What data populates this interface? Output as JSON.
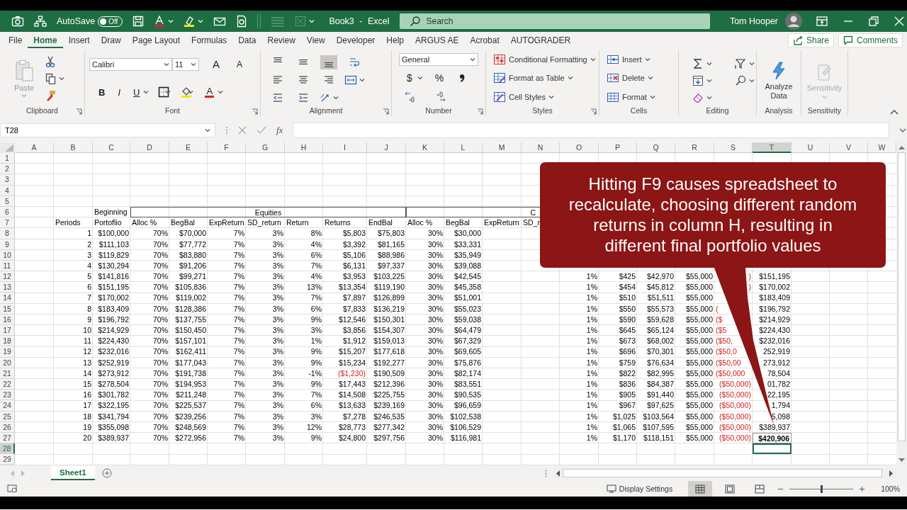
{
  "title_bar": {
    "autosave": {
      "label": "AutoSave",
      "on": false,
      "state": "Off"
    },
    "document": "Book3 - Excel",
    "search": {
      "placeholder": "Search"
    },
    "user": "Tom Hooper"
  },
  "menu_tabs": [
    {
      "label": "File",
      "selected": false
    },
    {
      "label": "Home",
      "selected": true
    },
    {
      "label": "Insert",
      "selected": false
    },
    {
      "label": "Draw",
      "selected": false
    },
    {
      "label": "Page Layout",
      "selected": false
    },
    {
      "label": "Formulas",
      "selected": false
    },
    {
      "label": "Data",
      "selected": false
    },
    {
      "label": "Review",
      "selected": false
    },
    {
      "label": "View",
      "selected": false
    },
    {
      "label": "Developer",
      "selected": false
    },
    {
      "label": "Help",
      "selected": false
    },
    {
      "label": "ARGUS AE",
      "selected": false
    },
    {
      "label": "Acrobat",
      "selected": false
    },
    {
      "label": "AUTOGRADER",
      "selected": false
    }
  ],
  "share": {
    "label": "Share"
  },
  "comments": {
    "label": "Comments"
  },
  "ribbon": {
    "clipboard": {
      "label": "Clipboard",
      "paste": {
        "label": "Paste",
        "disabled": true
      }
    },
    "font": {
      "label": "Font",
      "name": "Calibri",
      "size": "11",
      "grow": "A",
      "shrink": "A",
      "bold": "B",
      "italic": "I",
      "underline": "U",
      "font_color": "A"
    },
    "alignment": {
      "label": "Alignment",
      "vertical": [
        {
          "selected": false
        },
        {
          "selected": false
        },
        {
          "selected": true
        }
      ]
    },
    "number": {
      "label": "Number",
      "format": "General",
      "currency": "$",
      "percent": "%"
    },
    "styles": {
      "label": "Styles",
      "items": [
        "Conditional Formatting",
        "Format as Table",
        "Cell Styles"
      ]
    },
    "cells": {
      "label": "Cells",
      "items": [
        "Insert",
        "Delete",
        "Format"
      ]
    },
    "editing": {
      "label": "Editing"
    },
    "analysis": {
      "label": "Analysis",
      "button": "Analyze Data"
    },
    "sensitivity": {
      "label": "Sensitivity",
      "button": {
        "label": "Sensitivity",
        "disabled": true
      }
    }
  },
  "formula_bar": {
    "name_box": "T28",
    "fx": "fx"
  },
  "sheet": {
    "columns": {
      "A": {
        "label": "A",
        "selected": false
      },
      "B": {
        "label": "B",
        "selected": false
      },
      "C": {
        "label": "C",
        "selected": false
      },
      "D": {
        "label": "D",
        "selected": false
      },
      "E": {
        "label": "E",
        "selected": false
      },
      "F": {
        "label": "F",
        "selected": false
      },
      "G": {
        "label": "G",
        "selected": false
      },
      "H": {
        "label": "H",
        "selected": false
      },
      "I": {
        "label": "I",
        "selected": false
      },
      "J": {
        "label": "J",
        "selected": false
      },
      "K": {
        "label": "K",
        "selected": false
      },
      "L": {
        "label": "L",
        "selected": false
      },
      "M": {
        "label": "M",
        "selected": false
      },
      "N": {
        "label": "N",
        "selected": false
      },
      "O": {
        "label": "O",
        "selected": false
      },
      "P": {
        "label": "P",
        "selected": false
      },
      "Q": {
        "label": "Q",
        "selected": false
      },
      "R": {
        "label": "R",
        "selected": false
      },
      "S": {
        "label": "S",
        "selected": false
      },
      "T": {
        "label": "T",
        "selected": true
      },
      "U": {
        "label": "U",
        "selected": false
      },
      "V": {
        "label": "V",
        "selected": false
      },
      "W": {
        "label": "W",
        "selected": false
      }
    },
    "rows": [
      {
        "number": "1",
        "selected": false
      },
      {
        "number": "2",
        "selected": false
      },
      {
        "number": "3",
        "selected": false
      },
      {
        "number": "4",
        "selected": false
      },
      {
        "number": "5",
        "selected": false
      },
      {
        "number": "6",
        "selected": false,
        "kind": "header",
        "cells": {
          "C": "Beginning",
          "D-J": "Equities",
          "K-N": {
            "text": "C",
            "cut_right": true
          }
        }
      },
      {
        "number": "7",
        "selected": false,
        "kind": "header",
        "cells": {
          "B": "Periods",
          "C": "Portoflio",
          "D": "Alloc %",
          "E": "BegBal",
          "F": "ExpReturn",
          "G": "SD_return",
          "H": "Return",
          "I": "Returns",
          "J": "EndBal",
          "K": "Alloc %",
          "L": "BegBal",
          "M": "ExpReturn",
          "N": "SD_r"
        }
      },
      {
        "number": "8",
        "selected": false,
        "kind": "data",
        "cells": {
          "B": "1",
          "C": "$100,000",
          "D": "70%",
          "E": "$70,000",
          "F": "7%",
          "G": "3%",
          "H": "8%",
          "I": "$5,803",
          "J": "$75,803",
          "K": "30%",
          "L": "$30,000"
        }
      },
      {
        "number": "9",
        "selected": false,
        "kind": "data",
        "cells": {
          "B": "2",
          "C": "$111,103",
          "D": "70%",
          "E": "$77,772",
          "F": "7%",
          "G": "3%",
          "H": "4%",
          "I": "$3,392",
          "J": "$81,165",
          "K": "30%",
          "L": "$33,331"
        }
      },
      {
        "number": "10",
        "selected": false,
        "kind": "data",
        "cells": {
          "B": "3",
          "C": "$119,829",
          "D": "70%",
          "E": "$83,880",
          "F": "7%",
          "G": "3%",
          "H": "6%",
          "I": "$5,106",
          "J": "$88,986",
          "K": "30%",
          "L": "$35,949"
        }
      },
      {
        "number": "11",
        "selected": false,
        "kind": "data",
        "cells": {
          "B": "4",
          "C": "$130,294",
          "D": "70%",
          "E": "$91,206",
          "F": "7%",
          "G": "3%",
          "H": "7%",
          "I": "$6,131",
          "J": "$97,337",
          "K": "30%",
          "L": "$39,088"
        }
      },
      {
        "number": "12",
        "selected": false,
        "kind": "data",
        "cells": {
          "B": "5",
          "C": "$141,816",
          "D": "70%",
          "E": "$99,271",
          "F": "7%",
          "G": "3%",
          "H": "4%",
          "I": "$3,953",
          "J": "$103,225",
          "K": "30%",
          "L": "$42,545",
          "O": "1%",
          "P": "$425",
          "Q": "$42,970",
          "R": "$55,000",
          "S": {
            "text": ")",
            "negative": true
          },
          "T": "$151,195"
        }
      },
      {
        "number": "13",
        "selected": false,
        "kind": "data",
        "cells": {
          "B": "6",
          "C": "$151,195",
          "D": "70%",
          "E": "$105,836",
          "F": "7%",
          "G": "3%",
          "H": "13%",
          "I": "$13,354",
          "J": "$119,190",
          "K": "30%",
          "L": "$45,358",
          "O": "1%",
          "P": "$454",
          "Q": "$45,812",
          "R": "$55,000",
          "S": {
            "text": ")",
            "negative": true
          },
          "T": "$170,002"
        }
      },
      {
        "number": "14",
        "selected": false,
        "kind": "data",
        "cells": {
          "B": "7",
          "C": "$170,002",
          "D": "70%",
          "E": "$119,002",
          "F": "7%",
          "G": "3%",
          "H": "7%",
          "I": "$7,897",
          "J": "$126,899",
          "K": "30%",
          "L": "$51,001",
          "O": "1%",
          "P": "$510",
          "Q": "$51,511",
          "R": "$55,000",
          "T": "$183,409"
        }
      },
      {
        "number": "15",
        "selected": false,
        "kind": "data",
        "cells": {
          "B": "8",
          "C": "$183,409",
          "D": "70%",
          "E": "$128,386",
          "F": "7%",
          "G": "3%",
          "H": "6%",
          "I": "$7,833",
          "J": "$136,219",
          "K": "30%",
          "L": "$55,023",
          "O": "1%",
          "P": "$550",
          "Q": "$55,573",
          "R": "$55,000",
          "S": {
            "text": "(",
            "negative": true,
            "cut_right": true
          },
          "T": "$196,792"
        }
      },
      {
        "number": "16",
        "selected": false,
        "kind": "data",
        "cells": {
          "B": "9",
          "C": "$196,792",
          "D": "70%",
          "E": "$137,755",
          "F": "7%",
          "G": "3%",
          "H": "9%",
          "I": "$12,546",
          "J": "$150,301",
          "K": "30%",
          "L": "$59,038",
          "O": "1%",
          "P": "$590",
          "Q": "$59,628",
          "R": "$55,000",
          "S": {
            "text": "($",
            "negative": true,
            "cut_right": true
          },
          "T": "$214,929"
        }
      },
      {
        "number": "17",
        "selected": false,
        "kind": "data",
        "cells": {
          "B": "10",
          "C": "$214,929",
          "D": "70%",
          "E": "$150,450",
          "F": "7%",
          "G": "3%",
          "H": "3%",
          "I": "$3,856",
          "J": "$154,307",
          "K": "30%",
          "L": "$64,479",
          "O": "1%",
          "P": "$645",
          "Q": "$65,124",
          "R": "$55,000",
          "S": {
            "text": "($5",
            "negative": true,
            "cut_right": true
          },
          "T": "$224,430"
        }
      },
      {
        "number": "18",
        "selected": false,
        "kind": "data",
        "cells": {
          "B": "11",
          "C": "$224,430",
          "D": "70%",
          "E": "$157,101",
          "F": "7%",
          "G": "3%",
          "H": "1%",
          "I": "$1,912",
          "J": "$159,013",
          "K": "30%",
          "L": "$67,329",
          "O": "1%",
          "P": "$673",
          "Q": "$68,002",
          "R": "$55,000",
          "S": {
            "text": "($50,",
            "negative": true,
            "cut_right": true
          },
          "T": "$232,016"
        }
      },
      {
        "number": "19",
        "selected": false,
        "kind": "data",
        "cells": {
          "B": "12",
          "C": "$232,016",
          "D": "70%",
          "E": "$162,411",
          "F": "7%",
          "G": "3%",
          "H": "9%",
          "I": "$15,207",
          "J": "$177,618",
          "K": "30%",
          "L": "$69,605",
          "O": "1%",
          "P": "$696",
          "Q": "$70,301",
          "R": "$55,000",
          "S": {
            "text": "($50,0",
            "negative": true,
            "cut_right": true
          },
          "T": "252,919"
        }
      },
      {
        "number": "20",
        "selected": false,
        "kind": "data",
        "cells": {
          "B": "13",
          "C": "$252,919",
          "D": "70%",
          "E": "$177,043",
          "F": "7%",
          "G": "3%",
          "H": "9%",
          "I": "$15,234",
          "J": "$192,277",
          "K": "30%",
          "L": "$75,876",
          "O": "1%",
          "P": "$759",
          "Q": "$76,634",
          "R": "$55,000",
          "S": {
            "text": "($50,00",
            "negative": true,
            "cut_right": true
          },
          "T": "273,912"
        }
      },
      {
        "number": "21",
        "selected": false,
        "kind": "data",
        "cells": {
          "B": "14",
          "C": "$273,912",
          "D": "70%",
          "E": "$191,738",
          "F": "7%",
          "G": "3%",
          "H": "-1%",
          "I": {
            "text": "($1,230)",
            "negative": true
          },
          "J": "$190,509",
          "K": "30%",
          "L": "$82,174",
          "O": "1%",
          "P": "$822",
          "Q": "$82,995",
          "R": "$55,000",
          "S": {
            "text": "($50,000",
            "negative": true,
            "cut_right": true
          },
          "T": "78,504"
        }
      },
      {
        "number": "22",
        "selected": false,
        "kind": "data",
        "cells": {
          "B": "15",
          "C": "$278,504",
          "D": "70%",
          "E": "$194,953",
          "F": "7%",
          "G": "3%",
          "H": "9%",
          "I": "$17,443",
          "J": "$212,396",
          "K": "30%",
          "L": "$83,551",
          "O": "1%",
          "P": "$836",
          "Q": "$84,387",
          "R": "$55,000",
          "S": {
            "text": "($50,000)",
            "negative": true
          },
          "T": "01,782"
        }
      },
      {
        "number": "23",
        "selected": false,
        "kind": "data",
        "cells": {
          "B": "16",
          "C": "$301,782",
          "D": "70%",
          "E": "$211,248",
          "F": "7%",
          "G": "3%",
          "H": "7%",
          "I": "$14,508",
          "J": "$225,755",
          "K": "30%",
          "L": "$90,535",
          "O": "1%",
          "P": "$905",
          "Q": "$91,440",
          "R": "$55,000",
          "S": {
            "text": "($50,000)",
            "negative": true
          },
          "T": "22,195"
        }
      },
      {
        "number": "24",
        "selected": false,
        "kind": "data",
        "cells": {
          "B": "17",
          "C": "$322,195",
          "D": "70%",
          "E": "$225,537",
          "F": "7%",
          "G": "3%",
          "H": "6%",
          "I": "$13,633",
          "J": "$239,169",
          "K": "30%",
          "L": "$96,659",
          "O": "1%",
          "P": "$967",
          "Q": "$97,625",
          "R": "$55,000",
          "S": {
            "text": "($50,000)",
            "negative": true
          },
          "T": "1,794"
        }
      },
      {
        "number": "25",
        "selected": false,
        "kind": "data",
        "cells": {
          "B": "18",
          "C": "$341,794",
          "D": "70%",
          "E": "$239,256",
          "F": "7%",
          "G": "3%",
          "H": "3%",
          "I": "$7,278",
          "J": "$246,535",
          "K": "30%",
          "L": "$102,538",
          "O": "1%",
          "P": "$1,025",
          "Q": "$103,564",
          "R": "$55,000",
          "S": {
            "text": "($50,000)",
            "negative": true
          },
          "T": "5,098"
        }
      },
      {
        "number": "26",
        "selected": false,
        "kind": "data",
        "cells": {
          "B": "19",
          "C": "$355,098",
          "D": "70%",
          "E": "$248,569",
          "F": "7%",
          "G": "3%",
          "H": "12%",
          "I": "$28,773",
          "J": "$277,342",
          "K": "30%",
          "L": "$106,529",
          "O": "1%",
          "P": "$1,065",
          "Q": "$107,595",
          "R": "$55,000",
          "S": {
            "text": "($50,000)",
            "negative": true
          },
          "T": "$389,937"
        }
      },
      {
        "number": "27",
        "selected": false,
        "kind": "data",
        "cells": {
          "B": "20",
          "C": "$389,937",
          "D": "70%",
          "E": "$272,956",
          "F": "7%",
          "G": "3%",
          "H": "9%",
          "I": "$24,800",
          "J": "$297,756",
          "K": "30%",
          "L": "$116,981",
          "O": "1%",
          "P": "$1,170",
          "Q": "$118,151",
          "R": "$55,000",
          "S": {
            "text": "($50,000)",
            "negative": true
          },
          "T": {
            "text": "$420,906",
            "bold": true
          }
        }
      },
      {
        "number": "28",
        "selected": true
      },
      {
        "number": "29",
        "selected": false
      }
    ]
  },
  "callout": {
    "text": "Hitting F9 causes spreadsheet to recalculate, choosing different random returns in column H, resulting in different final portfolio values"
  },
  "sheet_tabs": [
    {
      "label": "Sheet1",
      "selected": true
    }
  ],
  "status_bar": {
    "display_settings": "Display Settings",
    "views": [
      {
        "selected": true
      },
      {
        "selected": false
      },
      {
        "selected": false
      }
    ],
    "zoom": {
      "level": 0.5,
      "reading": "100%"
    }
  }
}
